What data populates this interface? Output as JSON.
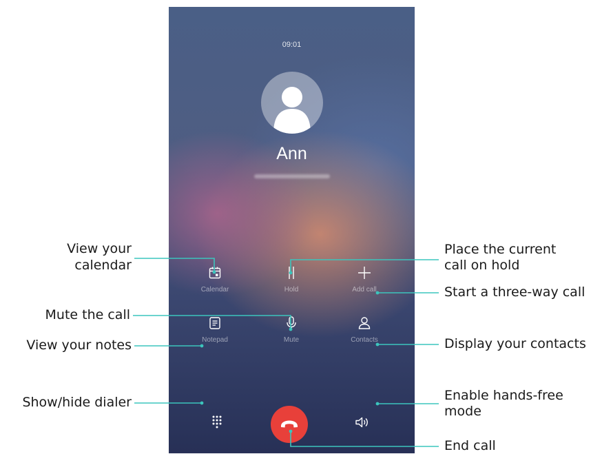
{
  "call_screen": {
    "time": "09:01",
    "caller_name": "Ann",
    "controls": {
      "calendar": "Calendar",
      "hold": "Hold",
      "add_call": "Add call",
      "notepad": "Notepad",
      "mute": "Mute",
      "contacts": "Contacts"
    },
    "colors": {
      "end_call": "#e8403a",
      "leader_line": "#3cc5bd"
    }
  },
  "annotations": {
    "view_calendar": [
      "View your",
      "calendar"
    ],
    "mute_call": "Mute the call",
    "view_notes": "View your notes",
    "show_hide_dialer": "Show/hide dialer",
    "place_hold": [
      "Place the current",
      "call on hold"
    ],
    "three_way": "Start a three-way call",
    "display_contacts": "Display your contacts",
    "hands_free": [
      "Enable hands-free",
      "mode"
    ],
    "end_call": "End call"
  },
  "icons": [
    "user-avatar-icon",
    "calendar-icon",
    "pause-icon",
    "plus-icon",
    "notepad-icon",
    "microphone-icon",
    "contacts-icon",
    "dialpad-icon",
    "phone-hangup-icon",
    "speaker-icon"
  ]
}
